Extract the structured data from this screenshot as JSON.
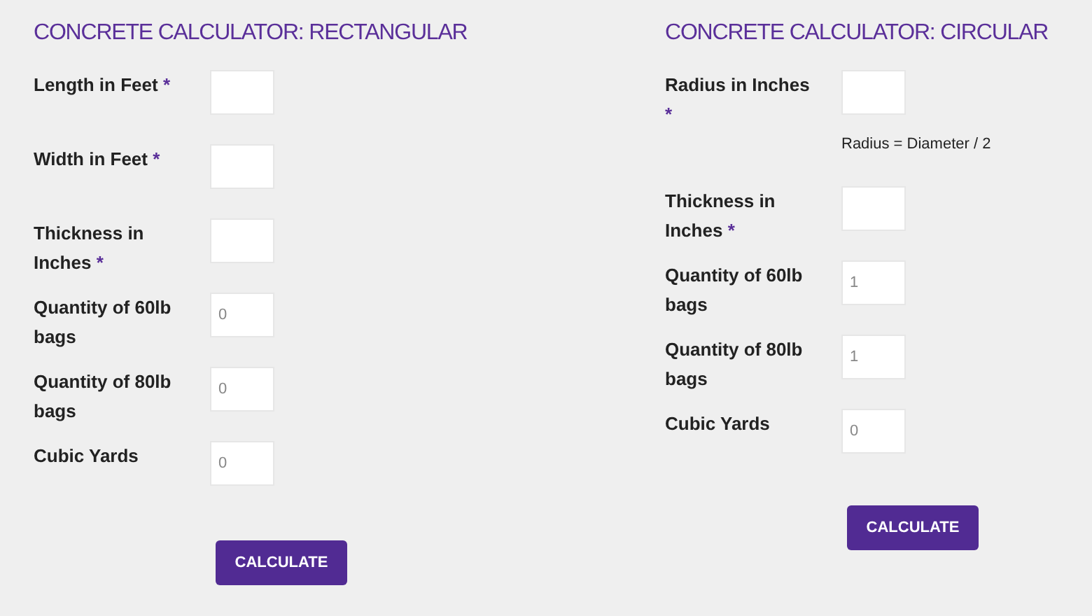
{
  "calculators": [
    {
      "title": "CONCRETE CALCULATOR: RECTANGULAR",
      "rows": [
        {
          "kind": "input",
          "label": "Length in Feet",
          "required_mark": "*"
        },
        {
          "kind": "input",
          "label": "Width in Feet",
          "required_mark": "*"
        },
        {
          "kind": "input",
          "label": "Thickness in Inches",
          "required_mark": "*"
        },
        {
          "kind": "input",
          "label": "Quantity of 60lb bags",
          "value": "0"
        },
        {
          "kind": "input",
          "label": "Quantity of 80lb bags",
          "value": "0"
        },
        {
          "kind": "input",
          "label": "Cubic Yards",
          "value": "0"
        }
      ],
      "button": "CALCULATE"
    },
    {
      "title": "CONCRETE CALCULATOR: CIRCULAR",
      "rows": [
        {
          "kind": "input",
          "label": "Radius in Inches",
          "required_mark": "*"
        },
        {
          "kind": "note",
          "text": "Radius = Diameter / 2"
        },
        {
          "kind": "input",
          "label": "Thickness in Inches",
          "required_mark": "*"
        },
        {
          "kind": "input",
          "label": "Quantity of 60lb bags",
          "value": "1"
        },
        {
          "kind": "input",
          "label": "Quantity of 80lb bags",
          "value": "1"
        },
        {
          "kind": "input",
          "label": "Cubic Yards",
          "value": "0"
        }
      ],
      "button": "CALCULATE"
    }
  ]
}
